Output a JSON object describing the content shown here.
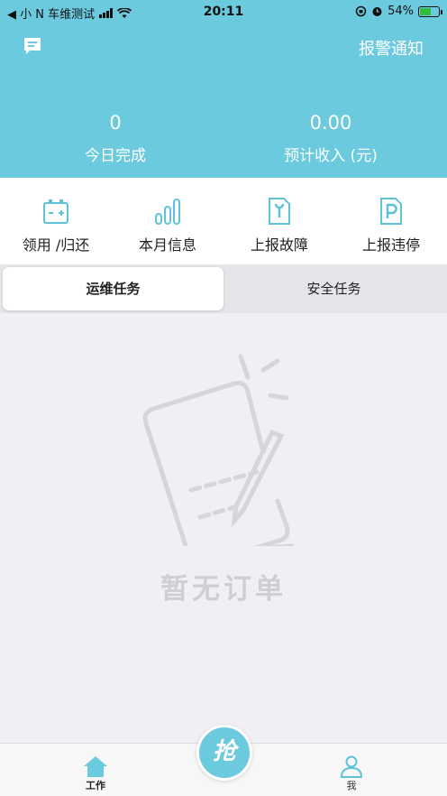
{
  "status_bar": {
    "back_label": "◀ 小 N 车维测试",
    "time": "20:11",
    "battery": "54%",
    "battery_level": 0.54
  },
  "header": {
    "alarm_link": "报警通知",
    "message_icon": "message-icon",
    "stats": [
      {
        "value": "0",
        "label": "今日完成"
      },
      {
        "value": "0.00",
        "label": "预计收入 (元)"
      }
    ]
  },
  "actions": [
    {
      "label": "领用 /归还",
      "icon": "battery-icon"
    },
    {
      "label": "本月信息",
      "icon": "bar-chart-icon"
    },
    {
      "label": "上报故障",
      "icon": "wrench-doc-icon"
    },
    {
      "label": "上报违停",
      "icon": "parking-icon"
    }
  ],
  "tabs": [
    {
      "label": "运维任务",
      "active": true
    },
    {
      "label": "安全任务",
      "active": false
    }
  ],
  "empty_state": {
    "text": "暂无订单",
    "icon": "empty-notepad-icon"
  },
  "tabbar": {
    "work_label": "工作",
    "grab_label": "抢",
    "me_label": "我"
  },
  "colors": {
    "accent": "#6ccadf",
    "empty_gray": "#cfcfd2"
  }
}
